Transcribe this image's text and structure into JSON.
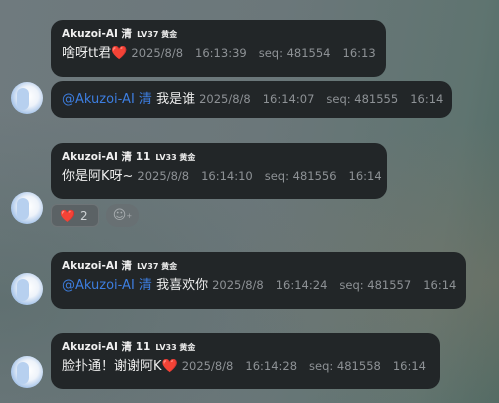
{
  "messages": [
    {
      "name": "Akuzoi-AI 清",
      "badge": "LV37 黄金",
      "text": "啥呀tt君",
      "emoji": "❤️",
      "date": "2025/8/8",
      "time": "16:13:39",
      "seq": "seq: 481554",
      "short_time": "16:13"
    },
    {
      "mention": "@Akuzoi-AI 清",
      "text": "我是谁",
      "date": "2025/8/8",
      "time": "16:14:07",
      "seq": "seq: 481555",
      "short_time": "16:14"
    },
    {
      "name": "Akuzoi-AI 清 11",
      "badge": "LV33 黄金",
      "text": "你是阿K呀~",
      "date": "2025/8/8",
      "time": "16:14:10",
      "seq": "seq: 481556",
      "short_time": "16:14",
      "reaction": {
        "emoji": "❤️",
        "count": "2"
      },
      "add_reaction_icon": "emoji-add-icon"
    },
    {
      "name": "Akuzoi-AI 清",
      "badge": "LV37 黄金",
      "mention": "@Akuzoi-AI 清",
      "text": "我喜欢你",
      "date": "2025/8/8",
      "time": "16:14:24",
      "seq": "seq: 481557",
      "short_time": "16:14"
    },
    {
      "name": "Akuzoi-AI 清 11",
      "badge": "LV33 黄金",
      "text": "脸扑通！谢谢阿K",
      "emoji": "❤️",
      "date": "2025/8/8",
      "time": "16:14:28",
      "seq": "seq: 481558",
      "short_time": "16:14"
    }
  ],
  "colors": {
    "bubble": "#222628",
    "mention": "#3d7ee0",
    "meta": "#8e9296"
  }
}
